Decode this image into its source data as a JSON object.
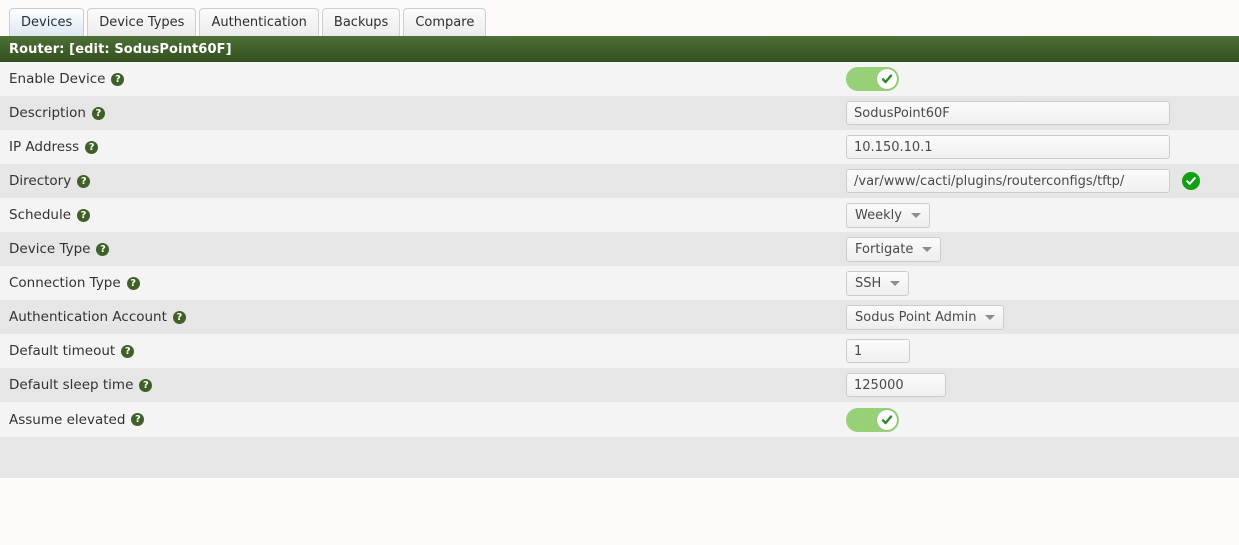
{
  "tabs": [
    {
      "label": "Devices",
      "selected": true
    },
    {
      "label": "Device Types",
      "selected": false
    },
    {
      "label": "Authentication",
      "selected": false
    },
    {
      "label": "Backups",
      "selected": false
    },
    {
      "label": "Compare",
      "selected": false
    }
  ],
  "titlebar": {
    "text": "Router: [edit: SodusPoint60F]"
  },
  "help_glyph": "?",
  "fields": {
    "enable_device": {
      "label": "Enable Device",
      "type": "toggle",
      "value": "on"
    },
    "description": {
      "label": "Description",
      "type": "text",
      "value": "SodusPoint60F",
      "placeholder": ""
    },
    "ip_address": {
      "label": "IP Address",
      "type": "text",
      "value": "10.150.10.1",
      "placeholder": ""
    },
    "directory": {
      "label": "Directory",
      "type": "text",
      "value": "/var/www/cacti/plugins/routerconfigs/tftp/",
      "placeholder": "",
      "valid": true
    },
    "schedule": {
      "label": "Schedule",
      "type": "select",
      "value": "Weekly"
    },
    "device_type": {
      "label": "Device Type",
      "type": "select",
      "value": "Fortigate"
    },
    "connection_type": {
      "label": "Connection Type",
      "type": "select",
      "value": "SSH"
    },
    "auth_account": {
      "label": "Authentication Account",
      "type": "select",
      "value": "Sodus Point Admin"
    },
    "default_timeout": {
      "label": "Default timeout",
      "type": "text",
      "value": "1",
      "placeholder": ""
    },
    "default_sleep": {
      "label": "Default sleep time",
      "type": "text",
      "value": "125000",
      "placeholder": ""
    },
    "assume_elevated": {
      "label": "Assume elevated",
      "type": "toggle",
      "value": "on"
    }
  },
  "colors": {
    "titlebar_green_top": "#4e7037",
    "titlebar_green_bottom": "#33501f",
    "toggle_on": "#97d077",
    "help_icon": "#3f6128",
    "valid_check": "#12a012",
    "row_light": "#f4f4f4",
    "row_dark": "#e6e6e6",
    "page_bg": "#fdfaf9"
  }
}
